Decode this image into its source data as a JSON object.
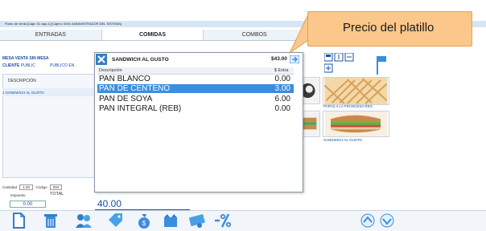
{
  "window": {
    "title": "Punto de venta  [Caja: 01 caja 1]   [Cajero: 0001 ADMINISTRADOR DEL SISTEMA]"
  },
  "tabs": [
    {
      "label": "ENTRADAS",
      "active": false
    },
    {
      "label": "COMIDAS",
      "active": true
    },
    {
      "label": "COMBOS",
      "active": false
    }
  ],
  "order": {
    "mesa": "MESA  VENTA SIN MESA",
    "cliente_label": "CLIENTE",
    "cliente_value": "PUBLIC",
    "cliente_extra": "PUBLICO EN",
    "column_header": "DESCRIPCIÓN",
    "items": [
      "1 SANDWICH AL GUSTO"
    ],
    "cantidad_label": "Cantidad",
    "cantidad_value": "1.00",
    "codigo_label": "Código",
    "codigo_value": "004",
    "impuesto_label": "Impuesto",
    "impuesto_value": "0.00",
    "total_label": "TOTAL",
    "total_value": "40.00"
  },
  "dialog": {
    "title": "SANDWICH AL GUSTO",
    "price": "$43.00",
    "col_description": "Descripción",
    "col_extra": "$ Extra",
    "rows": [
      {
        "desc": "PAN BLANCO",
        "extra": "0.00",
        "selected": false
      },
      {
        "desc": "PAN DE CENTENO",
        "extra": "3.00",
        "selected": true
      },
      {
        "desc": "PAN DE SOYA",
        "extra": "6.00",
        "selected": false
      },
      {
        "desc": "PAN INTEGRAL (REB)",
        "extra": "0.00",
        "selected": false
      }
    ]
  },
  "callout": {
    "text": "Precio del platillo"
  },
  "menu_items": [
    {
      "label": "PAPAS A LA FRANCESA REG"
    },
    {
      "label": "SANDWICH AL GUSTO"
    }
  ],
  "toolbar_icons": [
    "new-document-icon",
    "trash-icon",
    "users-icon",
    "discount-tag-icon",
    "money-bag-icon",
    "wallet-icon",
    "coupon-icon",
    "percent-discount-icon",
    "scroll-up-icon",
    "scroll-down-icon"
  ],
  "colors": {
    "accent_blue": "#1a4fa0",
    "selection_blue": "#3b8de0",
    "callout_orange": "#fbc78a"
  }
}
